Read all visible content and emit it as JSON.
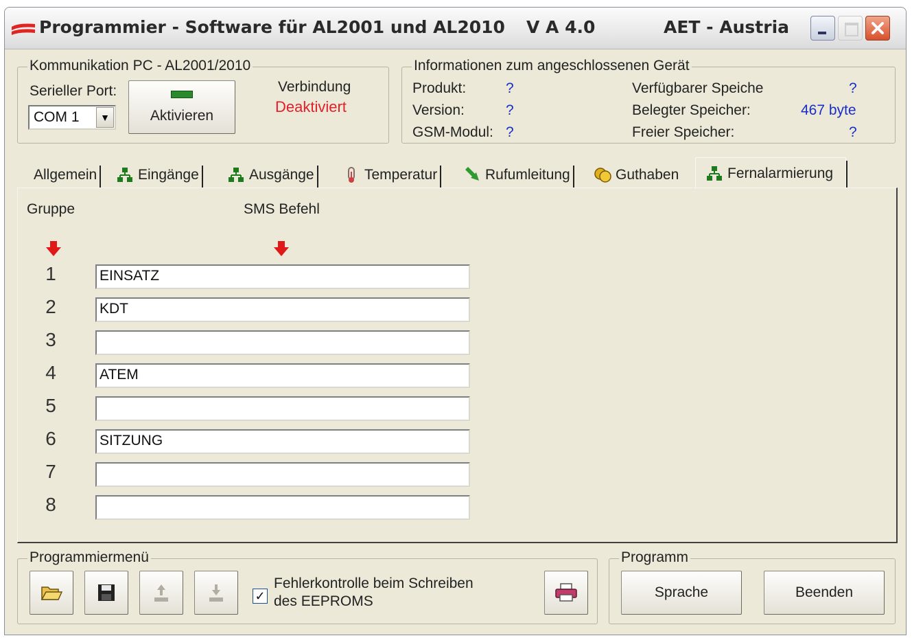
{
  "titlebar": {
    "title": "Programmier - Software für AL2001 und AL2010",
    "version": "V A 4.0",
    "company": "AET - Austria"
  },
  "comm": {
    "legend": "Kommunikation PC - AL2001/2010",
    "port_label": "Serieller Port:",
    "port_value": "COM 1",
    "activate_button": "Aktivieren",
    "connection_label": "Verbindung",
    "connection_status": "Deaktiviert",
    "connection_status_color": "#e0202a"
  },
  "info": {
    "legend": "Informationen zum angeschlossenen Gerät",
    "product_label": "Produkt:",
    "product_value": "?",
    "version_label": "Version:",
    "version_value": "?",
    "gsm_label": "GSM-Modul:",
    "gsm_value": "?",
    "available_label": "Verfügbarer Speiche",
    "available_value": "?",
    "used_label": "Belegter Speicher:",
    "used_value": "467 byte",
    "free_label": "Freier Speicher:",
    "free_value": "?"
  },
  "tabs": [
    {
      "label": "Allgemein",
      "icon": "none"
    },
    {
      "label": "Eingänge",
      "icon": "network-icon"
    },
    {
      "label": "Ausgänge",
      "icon": "network-icon"
    },
    {
      "label": "Temperatur",
      "icon": "thermometer-icon"
    },
    {
      "label": "Rufumleitung",
      "icon": "forward-arrow-icon"
    },
    {
      "label": "Guthaben",
      "icon": "coins-icon"
    },
    {
      "label": "Fernalarmierung",
      "icon": "network-icon"
    }
  ],
  "panel": {
    "group_header": "Gruppe",
    "sms_header": "SMS Befehl",
    "rows": [
      {
        "num": "1",
        "value": "EINSATZ"
      },
      {
        "num": "2",
        "value": "KDT"
      },
      {
        "num": "3",
        "value": ""
      },
      {
        "num": "4",
        "value": "ATEM"
      },
      {
        "num": "5",
        "value": ""
      },
      {
        "num": "6",
        "value": "SITZUNG"
      },
      {
        "num": "7",
        "value": ""
      },
      {
        "num": "8",
        "value": ""
      }
    ]
  },
  "progmenu": {
    "legend": "Programmiermenü",
    "check_line1": "Fehlerkontrolle beim Schreiben",
    "check_line2": "des EEPROMS",
    "checked": true
  },
  "program": {
    "legend": "Programm",
    "language_button": "Sprache",
    "exit_button": "Beenden"
  }
}
